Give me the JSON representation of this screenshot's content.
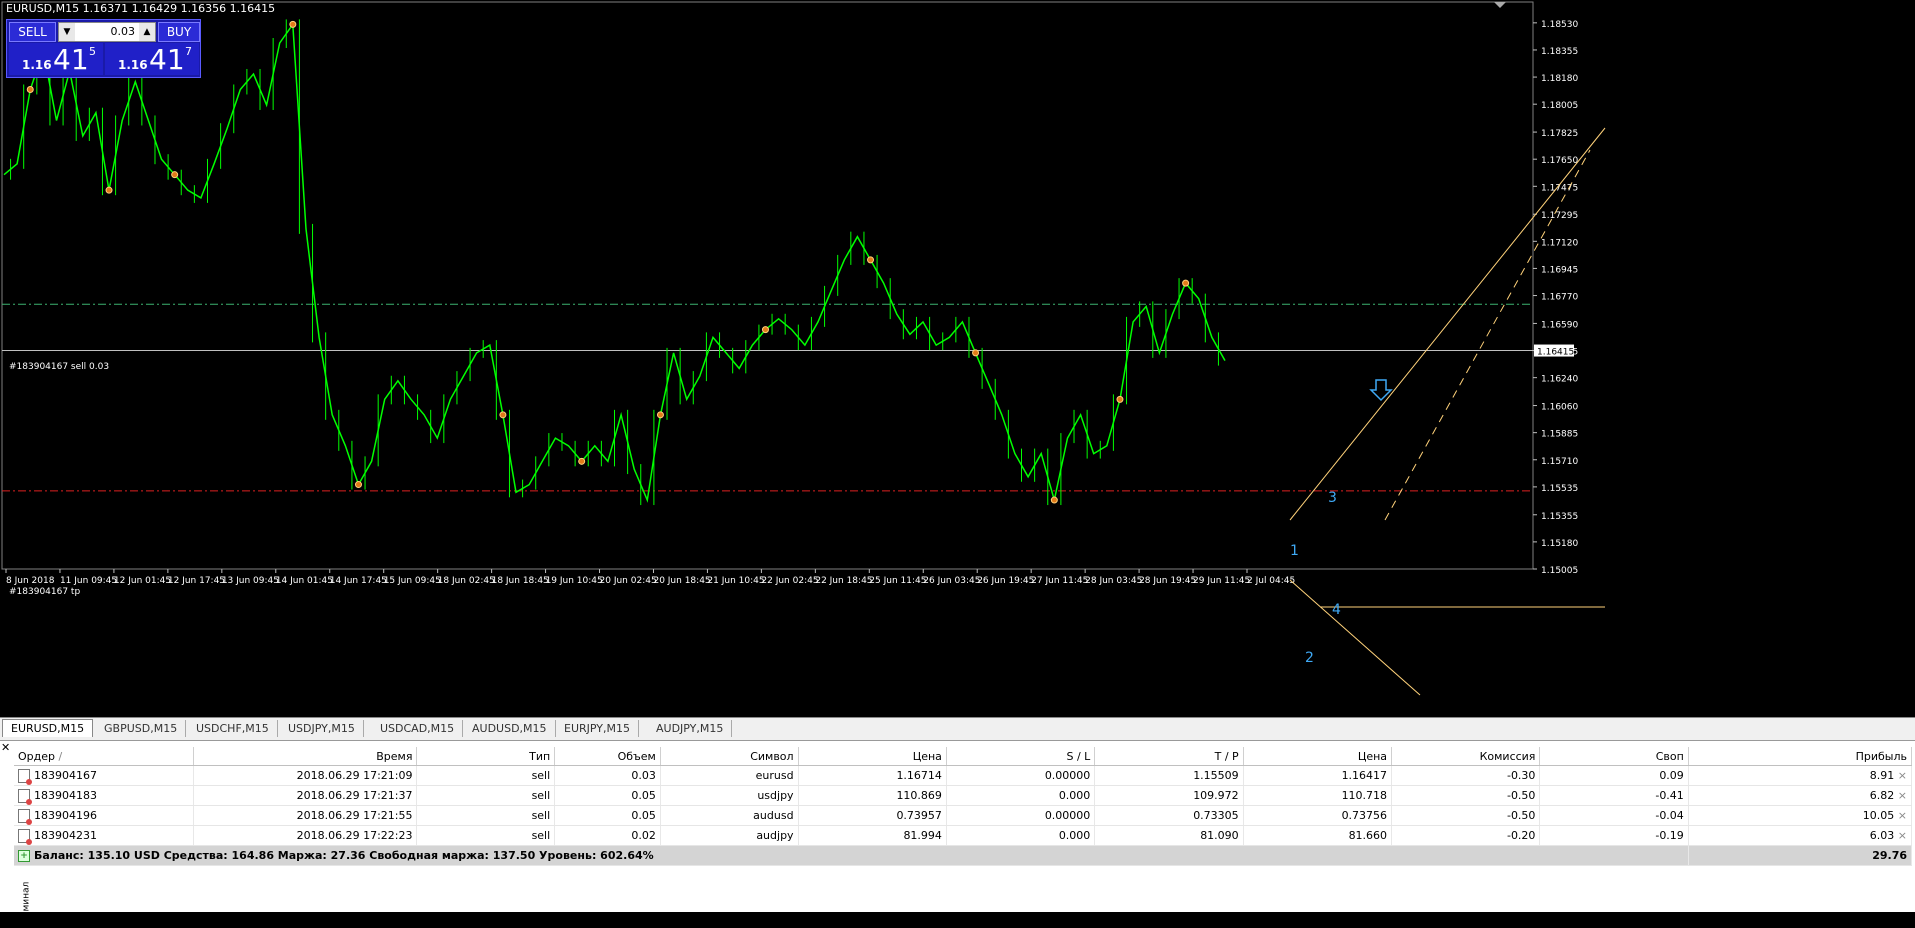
{
  "window_title": "EURUSD,M15  1.16371 1.16429 1.16356 1.16415",
  "one_click": {
    "sell_label": "SELL",
    "buy_label": "BUY",
    "lot_value": "0.03",
    "sell_price_prefix": "1.16",
    "sell_price_big": "41",
    "sell_price_sup": "5",
    "buy_price_prefix": "1.16",
    "buy_price_big": "41",
    "buy_price_sup": "7",
    "arrow_down": "▼",
    "arrow_up": "▲"
  },
  "chart_labels": {
    "sell_line": "#183904167 sell 0.03",
    "tp_line": "#183904167 tp",
    "wave_labels": [
      "1",
      "2",
      "3",
      "4"
    ]
  },
  "colors": {
    "background": "#000000",
    "price": "#00ff00",
    "sell_line": "#3cb371",
    "tp_line": "#dd2020",
    "trend": "#ffd27a",
    "bid_line": "#c0c0c0",
    "wave_label": "#3fa9f5"
  },
  "chart_data": {
    "type": "line",
    "title": "EURUSD,M15",
    "ylim": [
      1.15005,
      1.186
    ],
    "y_ticks": [
      "1.18530",
      "1.18355",
      "1.18180",
      "1.18005",
      "1.17825",
      "1.17650",
      "1.17475",
      "1.17295",
      "1.17120",
      "1.16945",
      "1.16770",
      "1.16590",
      "1.16415",
      "1.16240",
      "1.16060",
      "1.15885",
      "1.15710",
      "1.15535",
      "1.15355",
      "1.15180",
      "1.15005"
    ],
    "x_ticks": [
      "8 Jun 2018",
      "11 Jun 09:45",
      "12 Jun 01:45",
      "12 Jun 17:45",
      "13 Jun 09:45",
      "14 Jun 01:45",
      "14 Jun 17:45",
      "15 Jun 09:45",
      "18 Jun 02:45",
      "18 Jun 18:45",
      "19 Jun 10:45",
      "20 Jun 02:45",
      "20 Jun 18:45",
      "21 Jun 10:45",
      "22 Jun 02:45",
      "22 Jun 18:45",
      "25 Jun 11:45",
      "26 Jun 03:45",
      "26 Jun 19:45",
      "27 Jun 11:45",
      "28 Jun 03:45",
      "28 Jun 19:45",
      "29 Jun 11:45",
      "2 Jul 04:45"
    ],
    "current_price": "1.16415",
    "sell_price": 1.16714,
    "tp_price": 1.15509,
    "series": [
      {
        "values": [
          1.1755,
          1.1762,
          1.181,
          1.1835,
          1.179,
          1.1822,
          1.178,
          1.1795,
          1.1745,
          1.179,
          1.1815,
          1.179,
          1.1765,
          1.1755,
          1.1745,
          1.174,
          1.1762,
          1.1785,
          1.181,
          1.182,
          1.18,
          1.184,
          1.1852,
          1.172,
          1.165,
          1.16,
          1.158,
          1.1555,
          1.157,
          1.161,
          1.1622,
          1.161,
          1.16,
          1.1585,
          1.161,
          1.1625,
          1.164,
          1.1645,
          1.16,
          1.155,
          1.1555,
          1.157,
          1.1585,
          1.158,
          1.157,
          1.158,
          1.157,
          1.16,
          1.1565,
          1.1545,
          1.16,
          1.164,
          1.161,
          1.1625,
          1.165,
          1.164,
          1.163,
          1.1645,
          1.1655,
          1.1662,
          1.1655,
          1.1645,
          1.166,
          1.168,
          1.17,
          1.1715,
          1.17,
          1.1685,
          1.1665,
          1.1652,
          1.166,
          1.1645,
          1.165,
          1.166,
          1.164,
          1.162,
          1.16,
          1.1575,
          1.156,
          1.1575,
          1.1545,
          1.1585,
          1.16,
          1.1575,
          1.158,
          1.161,
          1.166,
          1.167,
          1.164,
          1.1665,
          1.1685,
          1.1675,
          1.165,
          1.1635
        ]
      }
    ]
  },
  "tabs": [
    "EURUSD,M15",
    "GBPUSD,M15",
    "USDCHF,M15",
    "USDJPY,M15",
    "USDCAD,M15",
    "AUDUSD,M15",
    "EURJPY,M15",
    "AUDJPY,M15"
  ],
  "terminal": {
    "close_symbol": "✕",
    "side_label": "Терминал",
    "columns": [
      "Ордер",
      "/",
      "Время",
      "Тип",
      "Объем",
      "Символ",
      "Цена",
      "S / L",
      "T / P",
      "Цена",
      "Комиссия",
      "Своп",
      "Прибыль"
    ],
    "rows": [
      {
        "order": "183904167",
        "time": "2018.06.29 17:21:09",
        "type": "sell",
        "volume": "0.03",
        "symbol": "eurusd",
        "price": "1.16714",
        "sl": "0.00000",
        "tp": "1.15509",
        "cur": "1.16417",
        "commission": "-0.30",
        "swap": "0.09",
        "profit": "8.91"
      },
      {
        "order": "183904183",
        "time": "2018.06.29 17:21:37",
        "type": "sell",
        "volume": "0.05",
        "symbol": "usdjpy",
        "price": "110.869",
        "sl": "0.000",
        "tp": "109.972",
        "cur": "110.718",
        "commission": "-0.50",
        "swap": "-0.41",
        "profit": "6.82"
      },
      {
        "order": "183904196",
        "time": "2018.06.29 17:21:55",
        "type": "sell",
        "volume": "0.05",
        "symbol": "audusd",
        "price": "0.73957",
        "sl": "0.00000",
        "tp": "0.73305",
        "cur": "0.73756",
        "commission": "-0.50",
        "swap": "-0.04",
        "profit": "10.05"
      },
      {
        "order": "183904231",
        "time": "2018.06.29 17:22:23",
        "type": "sell",
        "volume": "0.02",
        "symbol": "audjpy",
        "price": "81.994",
        "sl": "0.000",
        "tp": "81.090",
        "cur": "81.660",
        "commission": "-0.20",
        "swap": "-0.19",
        "profit": "6.03"
      }
    ],
    "close_row": "×",
    "summary": "Баланс: 135.10 USD  Средства: 164.86  Маржа: 27.36  Свободная маржа: 137.50  Уровень: 602.64%",
    "summary_total": "29.76"
  }
}
